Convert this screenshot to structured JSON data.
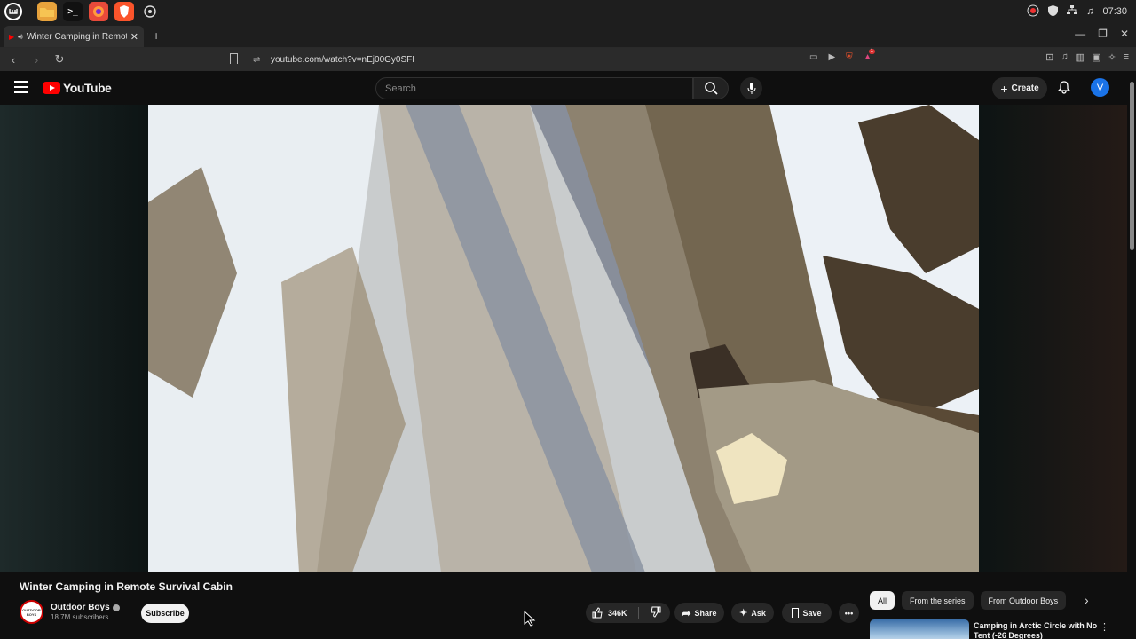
{
  "os": {
    "time": "07:30"
  },
  "browser": {
    "tab_title": "Winter Camping in Remote S",
    "url": "youtube.com/watch?v=nEj00Gy0SFI",
    "ext_badge": "1"
  },
  "youtube": {
    "logo_text": "YouTube",
    "search_placeholder": "Search",
    "create_label": "Create",
    "avatar_letter": "V"
  },
  "video": {
    "title": "Winter Camping in Remote Survival Cabin",
    "channel_name": "Outdoor Boys",
    "subscribers": "18.7M subscribers",
    "channel_logo_text": "OUTDOOR BOYS",
    "subscribe_label": "Subscribe",
    "likes": "346K",
    "share_label": "Share",
    "ask_label": "Ask",
    "save_label": "Save"
  },
  "chips": [
    "All",
    "From the series",
    "From Outdoor Boys"
  ],
  "recommendation": {
    "title": "Camping in Arctic Circle with No Tent (-26 Degrees)"
  },
  "colors": {
    "youtube_red": "#ff0000",
    "background": "#0f0f0f",
    "avatar_blue": "#1a73e8"
  }
}
